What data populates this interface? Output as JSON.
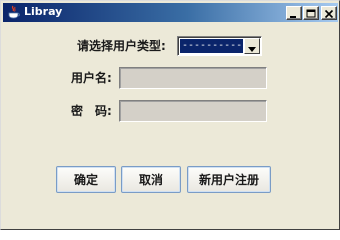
{
  "window": {
    "title": "Libray"
  },
  "title_icon": "java-icon",
  "controls": {
    "minimize": "minimize-icon",
    "maximize": "maximize-icon",
    "close": "close-icon"
  },
  "form": {
    "user_type_label": "请选择用户类型:",
    "user_type_selected": "----------",
    "username_label": "用户名:",
    "username_value": "",
    "password_label": "密　码:",
    "password_value": ""
  },
  "buttons": {
    "ok": "确定",
    "cancel": "取消",
    "register": "新用户注册"
  },
  "colors": {
    "title_start": "#0a246a",
    "title_end": "#a6caf0",
    "dialog_bg": "#ece9d8",
    "selection": "#0a246a"
  }
}
